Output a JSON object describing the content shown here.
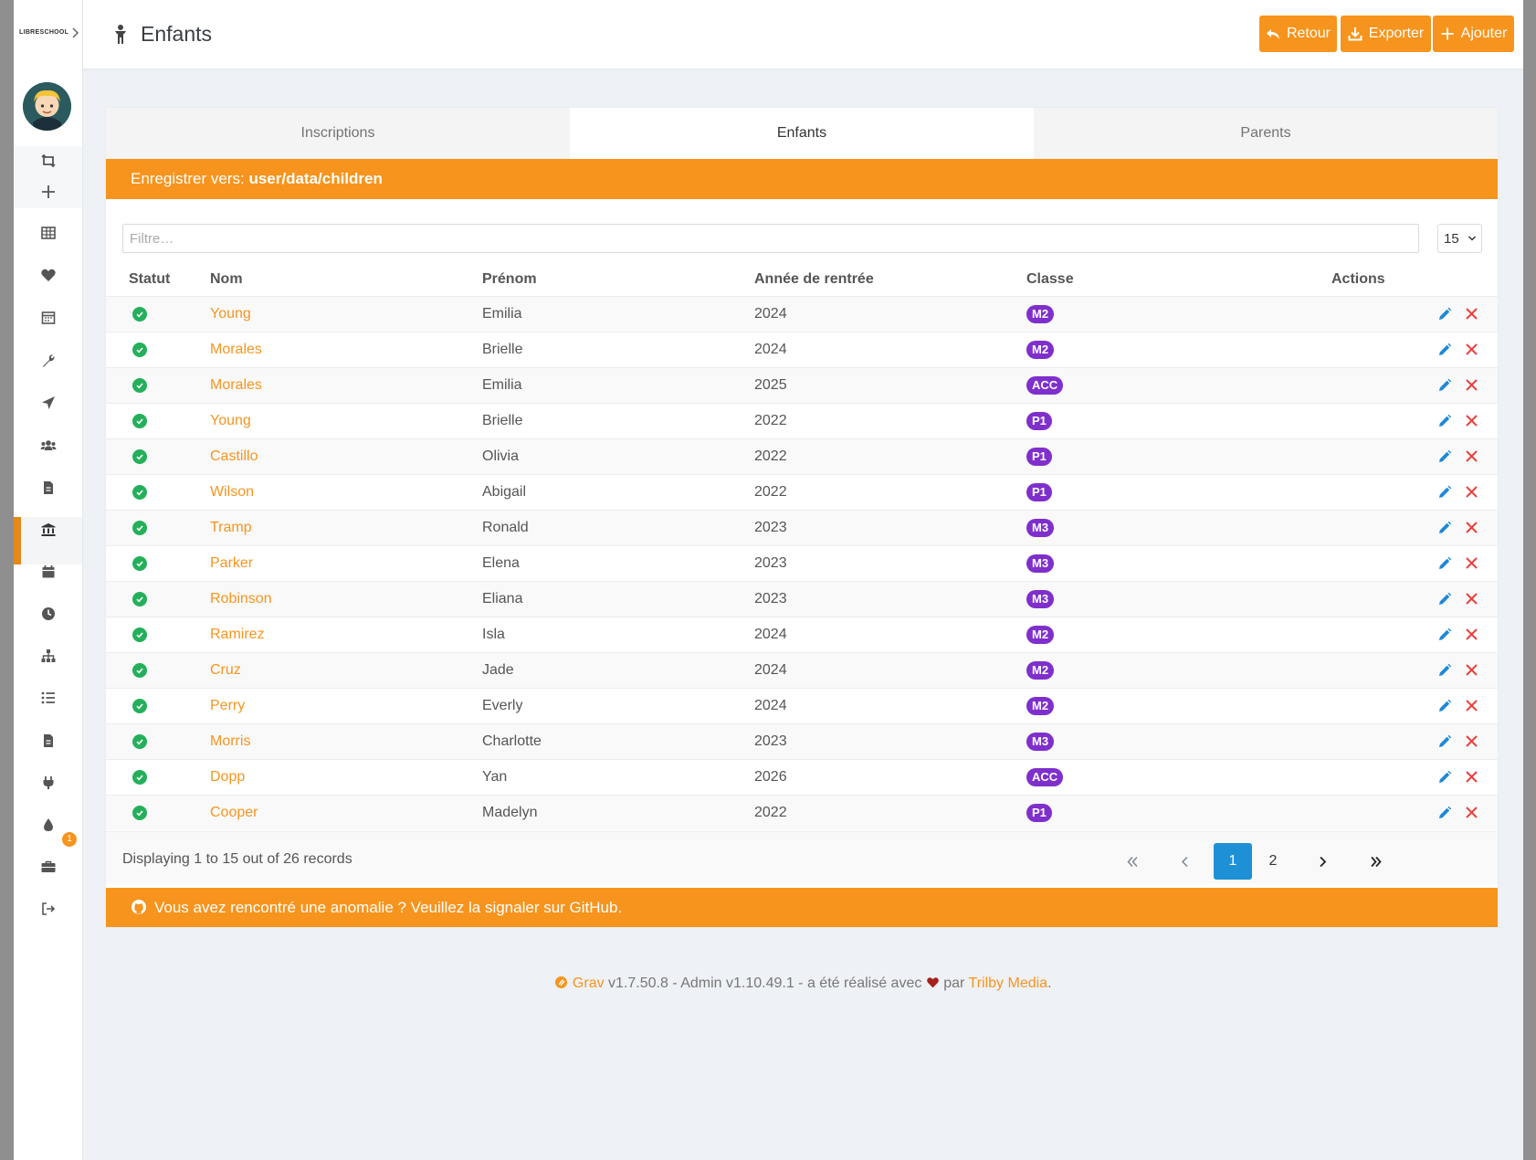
{
  "header": {
    "title": "Enfants",
    "buttons": {
      "back": "Retour",
      "export": "Exporter",
      "add": "Ajouter"
    }
  },
  "sidebar": {
    "logo": "LIBRESCHOOL",
    "notification_count": "1"
  },
  "tabs": [
    "Inscriptions",
    "Enfants",
    "Parents"
  ],
  "save_bar": {
    "label": "Enregistrer vers: ",
    "path": "user/data/children"
  },
  "filter": {
    "placeholder": "Filtre…",
    "per_page": "15"
  },
  "table": {
    "columns": [
      "Statut",
      "Nom",
      "Prénom",
      "Année de rentrée",
      "Classe",
      "Actions"
    ],
    "rows": [
      {
        "nom": "Young",
        "prenom": "Emilia",
        "annee": "2024",
        "classe": "M2"
      },
      {
        "nom": "Morales",
        "prenom": "Brielle",
        "annee": "2024",
        "classe": "M2"
      },
      {
        "nom": "Morales",
        "prenom": "Emilia",
        "annee": "2025",
        "classe": "ACC"
      },
      {
        "nom": "Young",
        "prenom": "Brielle",
        "annee": "2022",
        "classe": "P1"
      },
      {
        "nom": "Castillo",
        "prenom": "Olivia",
        "annee": "2022",
        "classe": "P1"
      },
      {
        "nom": "Wilson",
        "prenom": "Abigail",
        "annee": "2022",
        "classe": "P1"
      },
      {
        "nom": "Tramp",
        "prenom": "Ronald",
        "annee": "2023",
        "classe": "M3"
      },
      {
        "nom": "Parker",
        "prenom": "Elena",
        "annee": "2023",
        "classe": "M3"
      },
      {
        "nom": "Robinson",
        "prenom": "Eliana",
        "annee": "2023",
        "classe": "M3"
      },
      {
        "nom": "Ramirez",
        "prenom": "Isla",
        "annee": "2024",
        "classe": "M2"
      },
      {
        "nom": "Cruz",
        "prenom": "Jade",
        "annee": "2024",
        "classe": "M2"
      },
      {
        "nom": "Perry",
        "prenom": "Everly",
        "annee": "2024",
        "classe": "M2"
      },
      {
        "nom": "Morris",
        "prenom": "Charlotte",
        "annee": "2023",
        "classe": "M3"
      },
      {
        "nom": "Dopp",
        "prenom": "Yan",
        "annee": "2026",
        "classe": "ACC"
      },
      {
        "nom": "Cooper",
        "prenom": "Madelyn",
        "annee": "2022",
        "classe": "P1"
      }
    ]
  },
  "pagination": {
    "records": "Displaying 1 to 15 out of 26 records",
    "pages": [
      "1",
      "2"
    ],
    "current": "1"
  },
  "bug_bar": "Vous avez rencontré une anomalie ? Veuillez la signaler sur GitHub.",
  "footer": {
    "grav_link": "Grav",
    "version_text": " v1.7.50.8 - Admin v1.10.49.1 - a été réalisé avec ",
    "by_text": " par ",
    "trilby_link": "Trilby Media",
    "end": "."
  },
  "colors": {
    "accent": "#f7941d",
    "status_ok": "#24b05b",
    "badge": "#7f2fcc",
    "page_active": "#1e90d6",
    "edit": "#1e88d6",
    "delete": "#e8413c"
  }
}
